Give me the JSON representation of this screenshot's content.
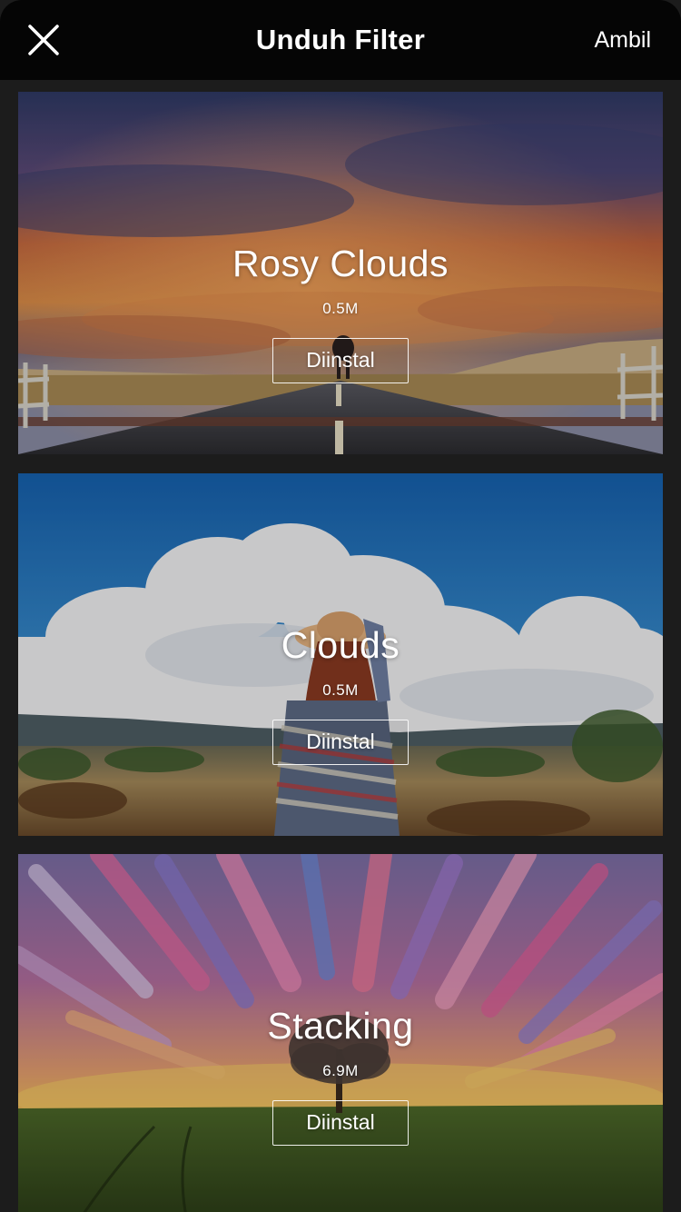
{
  "header": {
    "title": "Unduh Filter",
    "close_icon": "close-icon",
    "action_label": "Ambil"
  },
  "filters": [
    {
      "name": "Rosy Clouds",
      "size": "0.5M",
      "button_label": "Diinstal"
    },
    {
      "name": "Clouds",
      "size": "0.5M",
      "button_label": "Diinstal"
    },
    {
      "name": "Stacking",
      "size": "6.9M",
      "button_label": "Diinstal"
    }
  ],
  "colors": {
    "background": "#1c1c1c",
    "topbar": "#050505",
    "text": "#ffffff"
  }
}
